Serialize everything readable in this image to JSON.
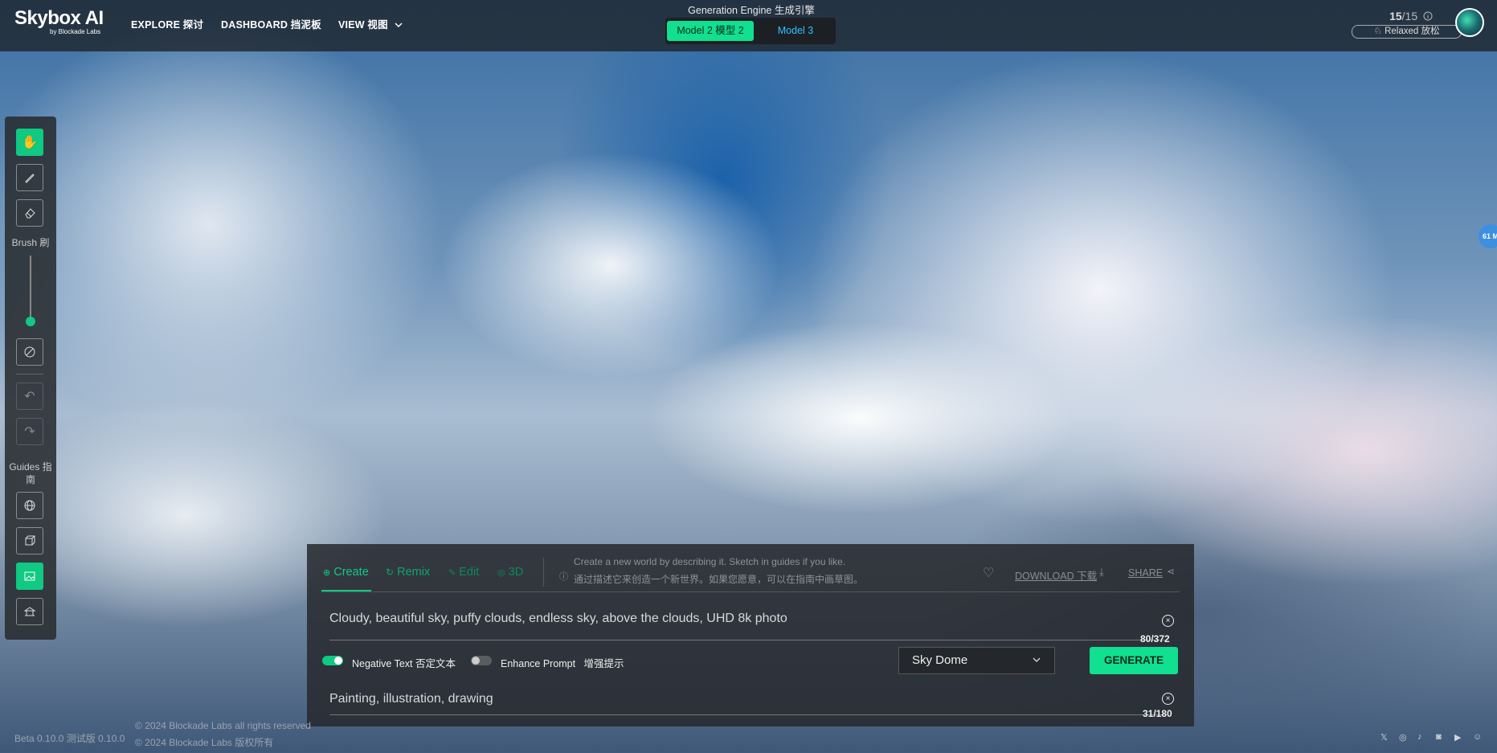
{
  "header": {
    "logo": "Skybox AI",
    "logo_sub": "by Blockade Labs",
    "nav": [
      "EXPLORE 探讨",
      "DASHBOARD 挡泥板",
      "VIEW 视图"
    ],
    "engine_label": "Generation Engine 生成引擎",
    "models": [
      "Model 2 模型 2",
      "Model 3"
    ],
    "credits_used": "15",
    "credits_total": "/15",
    "mode": "Relaxed 放松"
  },
  "toolbar": {
    "brush_label": "Brush 刷",
    "guides_label": "Guides 指南"
  },
  "panel": {
    "tabs": [
      "Create",
      "Remix",
      "Edit",
      "3D"
    ],
    "hint_en": "Create a new world by describing it. Sketch in guides if you like.",
    "hint_zh": "通过描述它来创造一个新世界。如果您愿意，可以在指南中画草图。",
    "download": "DOWNLOAD 下载",
    "share": "SHARE",
    "prompt": "Cloudy, beautiful sky, puffy clouds, endless sky, above the clouds, UHD 8k photo",
    "prompt_count": "80/372",
    "negative_toggle": "Negative Text 否定文本",
    "enhance_toggle": "Enhance Prompt   增强提示",
    "style": "Sky Dome",
    "generate": "GENERATE",
    "negative_prompt": "Painting, illustration, drawing",
    "negative_count": "31/180"
  },
  "footer": {
    "version": "Beta 0.10.0 测试版 0.10.0",
    "copyright_en": "© 2024 Blockade Labs all rights reserved",
    "copyright_zh": "© 2024 Blockade Labs 版权所有"
  },
  "bubble": "61 M",
  "colors": {
    "accent": "#10c982",
    "generate": "#10e08f",
    "model3": "#2ec4ff"
  }
}
